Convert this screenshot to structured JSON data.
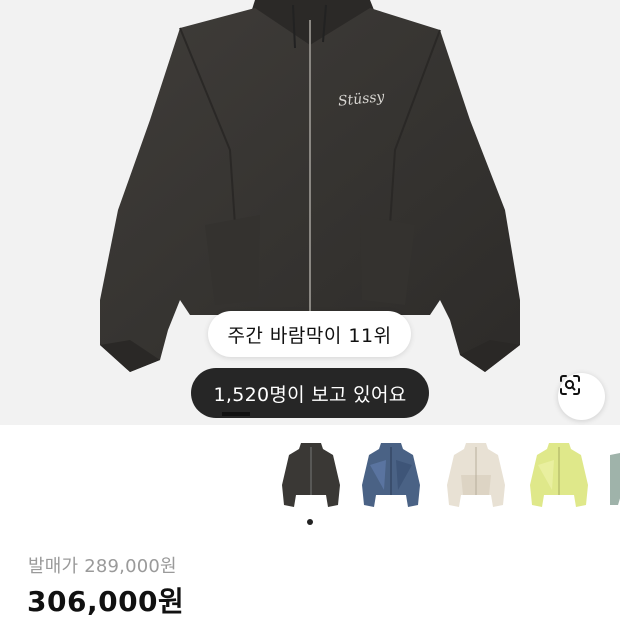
{
  "product": {
    "ranking_badge": "주간 바람막이 11위",
    "viewers_badge": "1,520명이 보고 있어요",
    "logo_text": "Stüssy",
    "release_price_label": "발매가 289,000원",
    "price": "306,000원"
  },
  "gallery": {
    "current_index": 1,
    "progress_fraction": 0.12,
    "colorways": [
      {
        "name": "charcoal",
        "color": "#3a3835"
      },
      {
        "name": "blue",
        "color": "#4a6285"
      },
      {
        "name": "cream",
        "color": "#e8e1d4"
      },
      {
        "name": "lime",
        "color": "#dfe88a"
      },
      {
        "name": "sage",
        "color": "#9fb3aa"
      }
    ]
  },
  "icons": {
    "scan": "image-search-icon"
  }
}
